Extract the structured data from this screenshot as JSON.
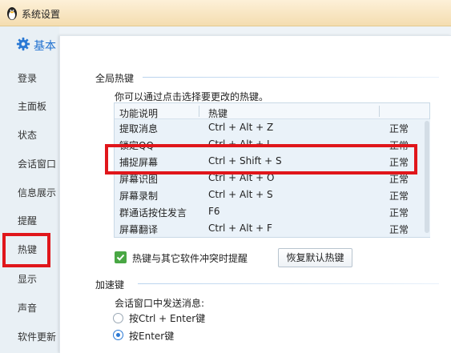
{
  "window": {
    "title": "系统设置"
  },
  "sidebar": {
    "basic_label": "基本",
    "items": [
      "登录",
      "主面板",
      "状态",
      "会话窗口",
      "信息展示",
      "提醒",
      "热键",
      "显示",
      "声音",
      "软件更新"
    ],
    "selected": "热键"
  },
  "hotkeys": {
    "section_title": "全局热键",
    "hint": "你可以通过点击选择要更改的热键。",
    "columns": [
      "功能说明",
      "热键",
      ""
    ],
    "rows": [
      {
        "name": "提取消息",
        "key": "Ctrl + Alt + Z",
        "status": "正常"
      },
      {
        "name": "锁定QQ",
        "key": "Ctrl + Alt + L",
        "status": "正常"
      },
      {
        "name": "捕捉屏幕",
        "key": "Ctrl + Shift + S",
        "status": "正常"
      },
      {
        "name": "屏幕识图",
        "key": "Ctrl + Alt + O",
        "status": "正常"
      },
      {
        "name": "屏幕录制",
        "key": "Ctrl + Alt + S",
        "status": "正常"
      },
      {
        "name": "群通话按住发言",
        "key": "F6",
        "status": "正常"
      },
      {
        "name": "屏幕翻译",
        "key": "Ctrl + Alt + F",
        "status": "正常"
      }
    ],
    "conflict_checkbox_label": "热键与其它软件冲突时提醒",
    "conflict_checked": true,
    "restore_button": "恢复默认热键"
  },
  "accelerator": {
    "section_title": "加速键",
    "send_label": "会话窗口中发送消息:",
    "options": [
      "按Ctrl + Enter键",
      "按Enter键"
    ],
    "selected_option": "按Enter键"
  },
  "colors": {
    "highlight": "#e0161b",
    "accent": "#1e6fcf",
    "check": "#49a744"
  }
}
